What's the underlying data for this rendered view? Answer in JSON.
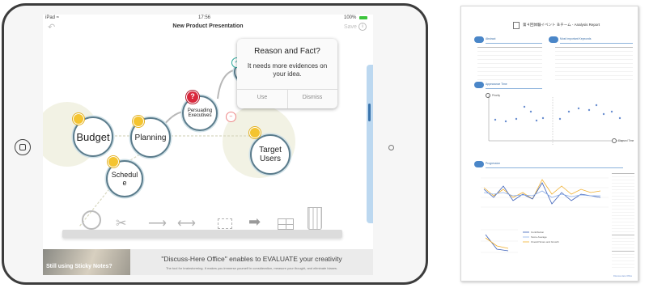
{
  "ipad": {
    "status": {
      "device": "iPad ≈",
      "time": "17:56",
      "battery": "100%"
    },
    "nav": {
      "title": "New Product Presentation",
      "save_label": "Save"
    },
    "popup": {
      "title": "Reason and Fact?",
      "message": "It needs more evidences on your idea.",
      "use_label": "Use",
      "dismiss_label": "Dismiss"
    },
    "nodes": {
      "budget": "Budget",
      "planning": "Planning",
      "schedule": "Schedul e",
      "persuading": "Persuading Executives",
      "target": "Target Users",
      "partial": "P..."
    },
    "banner": {
      "left_text": "Still using Sticky Notes?",
      "headline": "\"Discuss-Here Office\" enables to EVALUATE your creativity",
      "subtext": "The tool for brainstorming. It makes you immerse yourself in consideration, measure your thought, and eliminate biases."
    },
    "colors": {
      "node_border": "#5b7c8c",
      "bulb": "#f4c430",
      "alert": "#d9283c",
      "check": "#2aa89a"
    }
  },
  "report": {
    "title": "第４回体験イベント Ｂチーム - Analysis Report",
    "sections": {
      "abstract": "Abstract",
      "most_important": "Most Important Keywords",
      "appearance": "Appearance Time",
      "progression": "Progression"
    },
    "chart_axes": {
      "y": "Priority",
      "x": "Elapsed Time"
    },
    "legend": [
      "Contribution",
      "Score Average",
      "Overall Score and Growth"
    ],
    "footer": "Discuss-Here Office"
  }
}
